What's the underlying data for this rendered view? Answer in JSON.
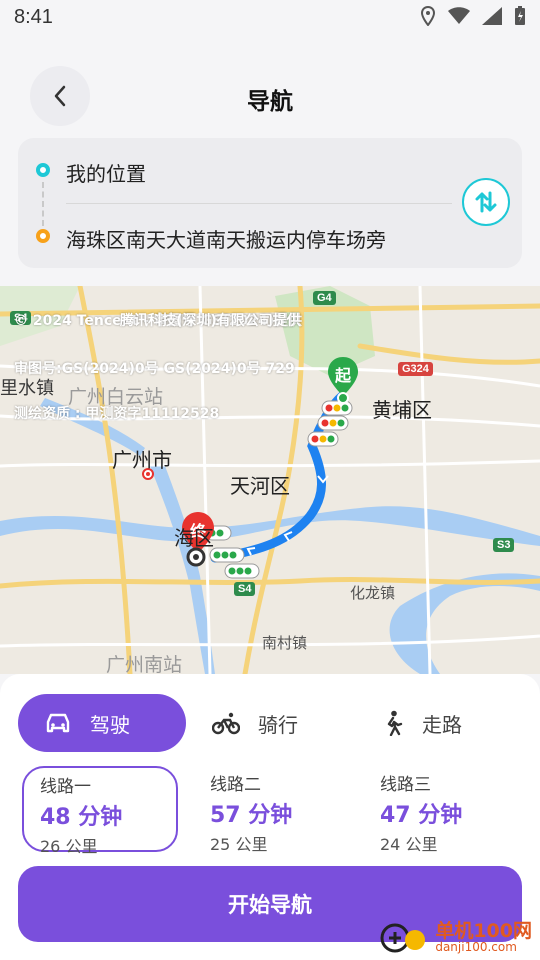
{
  "status_bar": {
    "time": "8:41"
  },
  "header": {
    "title": "导航"
  },
  "route": {
    "origin": "我的位置",
    "destination": "海珠区南天大道南天搬运内停车场旁"
  },
  "map": {
    "labels": {
      "huangpu": "黄埔区",
      "guangzhou": "广州市",
      "tianhe": "天河区",
      "haizhu": "海区",
      "baiyun_station": "广州白云站",
      "lishui": "里水镇",
      "hualong": "化龙镇",
      "nancun": "南村镇",
      "south_station": "广州南站"
    },
    "copyright_lines": [
      "© 2024 Tencent - 审图号 GS(2024)提供",
      "腾讯科技(深圳)有限公司提供",
      "审图号:GS(2024)0号  GS(2024)0号  729",
      "测绘资质 : 甲测资字11112528"
    ],
    "shields": {
      "g4": "G4",
      "s4": "S4",
      "s3": "S3",
      "g324": "G324",
      "s4b": "S4"
    },
    "markers": {
      "start": "起",
      "end": "终"
    },
    "colors": {
      "route": "#1e82f0",
      "start": "#2aa84a",
      "end": "#e8332e"
    }
  },
  "modes": {
    "drive": "驾驶",
    "cycle": "骑行",
    "walk": "走路"
  },
  "options": [
    {
      "name": "线路一",
      "time": "48 分钟",
      "distance": "26 公里"
    },
    {
      "name": "线路二",
      "time": "57 分钟",
      "distance": "25 公里"
    },
    {
      "name": "线路三",
      "time": "47 分钟",
      "distance": "24 公里"
    }
  ],
  "start_button": "开始导航",
  "watermark": {
    "main": "单机100网",
    "sub": "danji100.com"
  },
  "theme": {
    "accent": "#7a4fdc",
    "cyan": "#1ec8d6",
    "orange": "#f7a11a"
  }
}
